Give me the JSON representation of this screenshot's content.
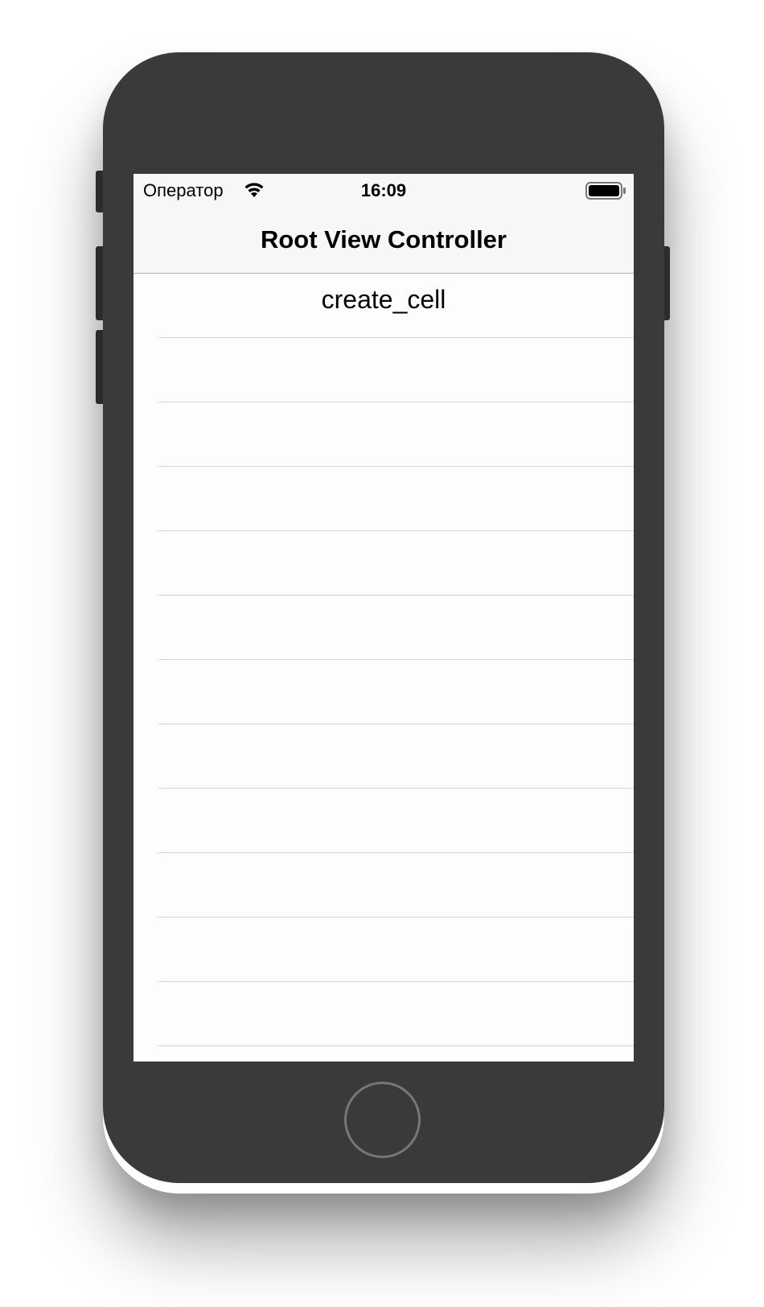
{
  "status_bar": {
    "carrier": "Оператор",
    "time": "16:09",
    "wifi_icon": "wifi-icon",
    "battery_icon": "battery-full-icon"
  },
  "nav_bar": {
    "title": "Root View Controller"
  },
  "table": {
    "rows": [
      {
        "label": "create_cell"
      },
      {
        "label": ""
      },
      {
        "label": ""
      },
      {
        "label": ""
      },
      {
        "label": ""
      },
      {
        "label": ""
      },
      {
        "label": ""
      },
      {
        "label": ""
      },
      {
        "label": ""
      },
      {
        "label": ""
      },
      {
        "label": ""
      },
      {
        "label": ""
      }
    ]
  },
  "device": {
    "home_button_icon": "home-button",
    "body_color": "#3a3a3a"
  }
}
